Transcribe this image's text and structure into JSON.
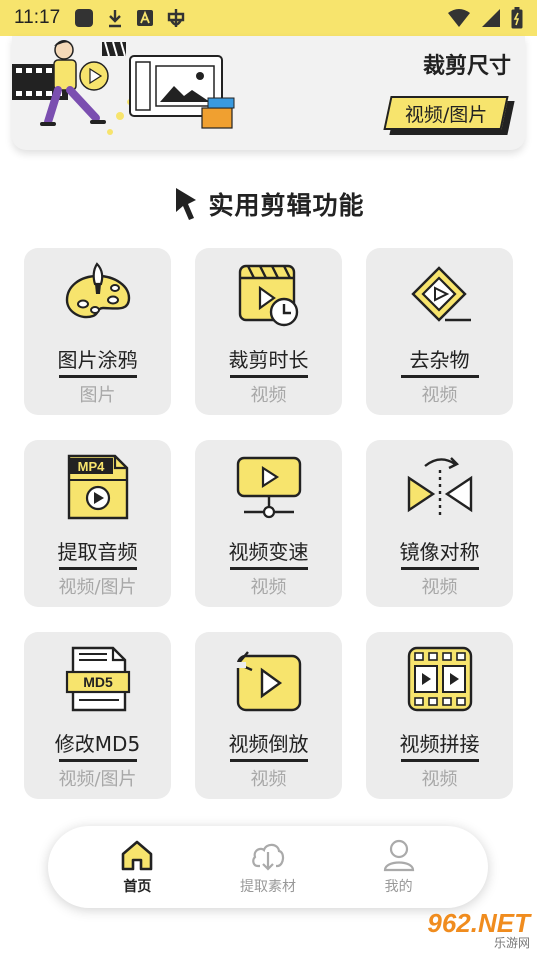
{
  "status_bar": {
    "time": "11:17",
    "icons": [
      "app-square-icon",
      "download-icon",
      "a-badge-icon",
      "bug-icon",
      "wifi-icon",
      "signal-icon",
      "battery-icon"
    ]
  },
  "banner": {
    "title": "裁剪尺寸",
    "tag": "视频/图片"
  },
  "section": {
    "title": "实用剪辑功能"
  },
  "tools": [
    {
      "name": "图片涂鸦",
      "sub": "图片",
      "icon": "palette-icon"
    },
    {
      "name": "裁剪时长",
      "sub": "视频",
      "icon": "clapper-clock-icon"
    },
    {
      "name": "去杂物",
      "sub": "视频",
      "icon": "eraser-icon"
    },
    {
      "name": "提取音频",
      "sub": "视频/图片",
      "icon": "mp4-file-icon",
      "icon_text": "MP4"
    },
    {
      "name": "视频变速",
      "sub": "视频",
      "icon": "video-network-icon"
    },
    {
      "name": "镜像对称",
      "sub": "视频",
      "icon": "mirror-flip-icon"
    },
    {
      "name": "修改MD5",
      "sub": "视频/图片",
      "icon": "md5-file-icon",
      "icon_text": "MD5"
    },
    {
      "name": "视频倒放",
      "sub": "视频",
      "icon": "reverse-play-icon"
    },
    {
      "name": "视频拼接",
      "sub": "视频",
      "icon": "film-join-icon"
    }
  ],
  "tabbar": {
    "items": [
      {
        "label": "首页",
        "icon": "home-icon",
        "active": true
      },
      {
        "label": "提取素材",
        "icon": "cloud-download-icon",
        "active": false
      },
      {
        "label": "我的",
        "icon": "user-icon",
        "active": false
      }
    ]
  },
  "watermark": {
    "logo": "962.NET",
    "sub": "乐游网"
  },
  "colors": {
    "accent": "#f7e46d",
    "card_bg": "#ececec",
    "text": "#222222",
    "subtext": "#a8a8a8"
  }
}
